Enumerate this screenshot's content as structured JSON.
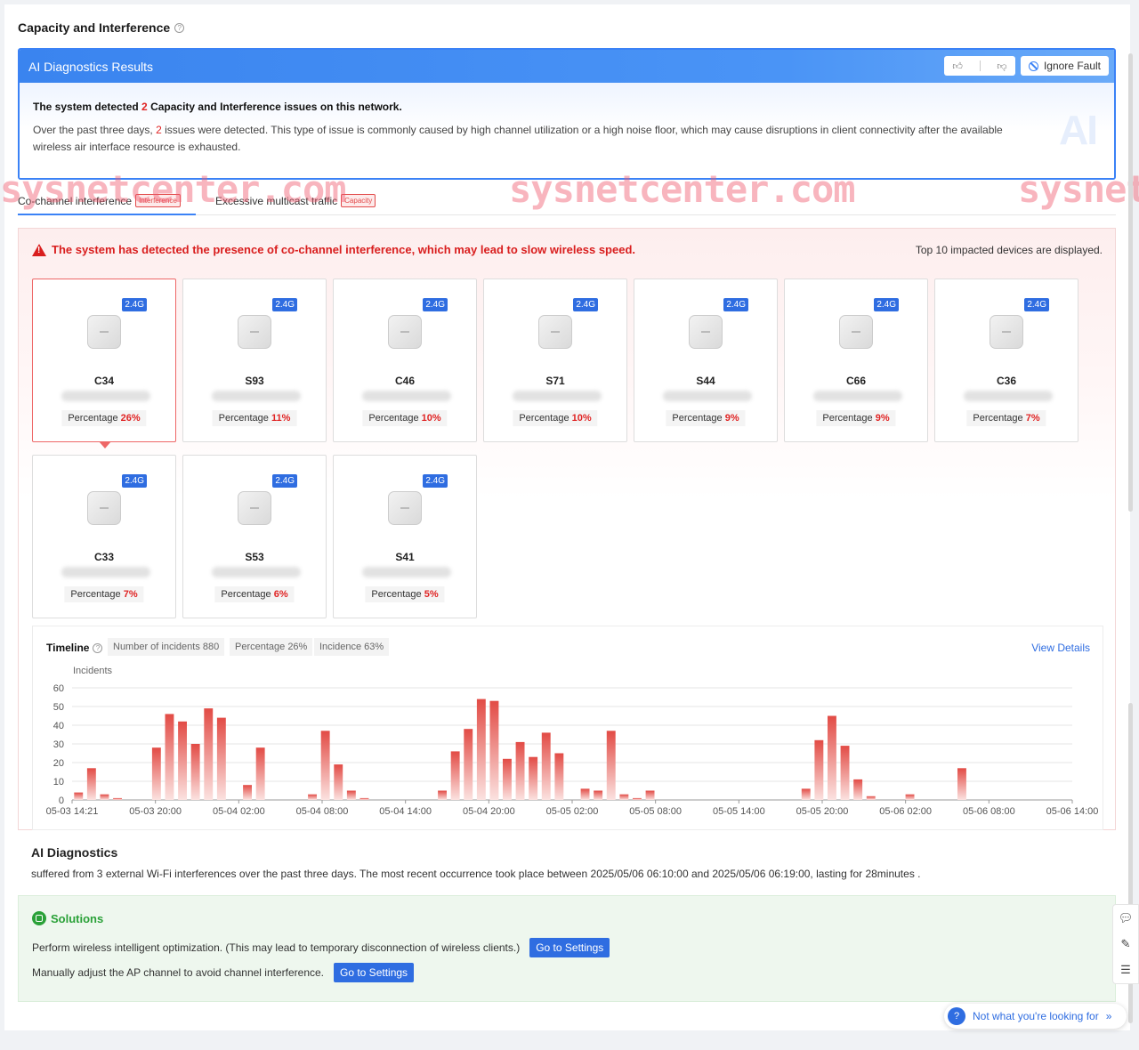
{
  "section": {
    "title": "Capacity and Interference"
  },
  "ai_results": {
    "header": "AI Diagnostics Results",
    "ignore_label": "Ignore Fault",
    "summary_prefix": "The system detected ",
    "summary_count": "2",
    "summary_suffix": " Capacity and Interference issues on this network.",
    "desc_prefix": "Over the past three days, ",
    "desc_count": "2",
    "desc_suffix": " issues were detected. This type of issue is commonly caused by high channel utilization or a high noise floor, which may cause disruptions in client connectivity after the available wireless air interface resource is exhausted.",
    "watermark": "AI"
  },
  "tabs": [
    {
      "label": "Co-channel interference",
      "badge": "Interference"
    },
    {
      "label": "Excessive multicast traffic",
      "badge": "Capacity"
    }
  ],
  "watermark_text": "sysnetcenter.com",
  "issue": {
    "title": "The system has detected the presence of co-channel interference, which may lead to slow wireless speed.",
    "top_note": "Top 10 impacted devices are displayed.",
    "pct_label": "Percentage",
    "devices": [
      {
        "name": "C34",
        "band": "2.4G",
        "pct": "26%"
      },
      {
        "name": "S93",
        "band": "2.4G",
        "pct": "11%"
      },
      {
        "name": "C46",
        "band": "2.4G",
        "pct": "10%"
      },
      {
        "name": "S71",
        "band": "2.4G",
        "pct": "10%"
      },
      {
        "name": "S44",
        "band": "2.4G",
        "pct": "9%"
      },
      {
        "name": "C66",
        "band": "2.4G",
        "pct": "9%"
      },
      {
        "name": "C36",
        "band": "2.4G",
        "pct": "7%"
      },
      {
        "name": "C33",
        "band": "2.4G",
        "pct": "7%"
      },
      {
        "name": "S53",
        "band": "2.4G",
        "pct": "6%"
      },
      {
        "name": "S41",
        "band": "2.4G",
        "pct": "5%"
      }
    ]
  },
  "timeline": {
    "title": "Timeline",
    "stats": [
      "Number of incidents 880",
      "Percentage 26%",
      "Incidence 63%"
    ],
    "view_details": "View Details"
  },
  "chart_data": {
    "type": "bar",
    "ylabel": "Incidents",
    "ylim": [
      0,
      60
    ],
    "yticks": [
      0,
      10,
      20,
      30,
      40,
      50,
      60
    ],
    "xlabels": [
      "05-03 14:21",
      "05-03 20:00",
      "05-04 02:00",
      "05-04 08:00",
      "05-04 14:00",
      "05-04 20:00",
      "05-05 02:00",
      "05-05 08:00",
      "05-05 14:00",
      "05-05 20:00",
      "05-06 02:00",
      "05-06 08:00",
      "05-06 14:00"
    ],
    "bar_color": "#e24b45",
    "values": [
      4,
      17,
      3,
      1,
      0,
      0,
      28,
      46,
      42,
      30,
      49,
      44,
      0,
      8,
      28,
      0,
      0,
      0,
      3,
      37,
      19,
      5,
      1,
      0,
      0,
      0,
      0,
      0,
      5,
      26,
      38,
      54,
      53,
      22,
      31,
      23,
      36,
      25,
      0,
      6,
      5,
      37,
      3,
      1,
      5,
      0,
      0,
      0,
      0,
      0,
      0,
      0,
      0,
      0,
      0,
      0,
      6,
      32,
      45,
      29,
      11,
      2,
      0,
      0,
      3,
      0,
      0,
      0,
      17,
      0,
      0,
      0,
      0,
      0,
      0,
      0,
      0
    ]
  },
  "diagnostics": {
    "title": "AI Diagnostics",
    "text": "suffered from 3 external Wi-Fi interferences over the past three days. The most recent occurrence took place between 2025/05/06 06:10:00 and 2025/05/06 06:19:00, lasting for 28minutes ."
  },
  "solutions": {
    "title": "Solutions",
    "items": [
      {
        "text": "Perform wireless intelligent optimization. (This may lead to temporary disconnection of wireless clients.)",
        "button": "Go to Settings"
      },
      {
        "text": "Manually adjust the AP channel to avoid channel interference.",
        "button": "Go to Settings"
      }
    ]
  },
  "help_float": {
    "label": "Not what you're looking for"
  }
}
